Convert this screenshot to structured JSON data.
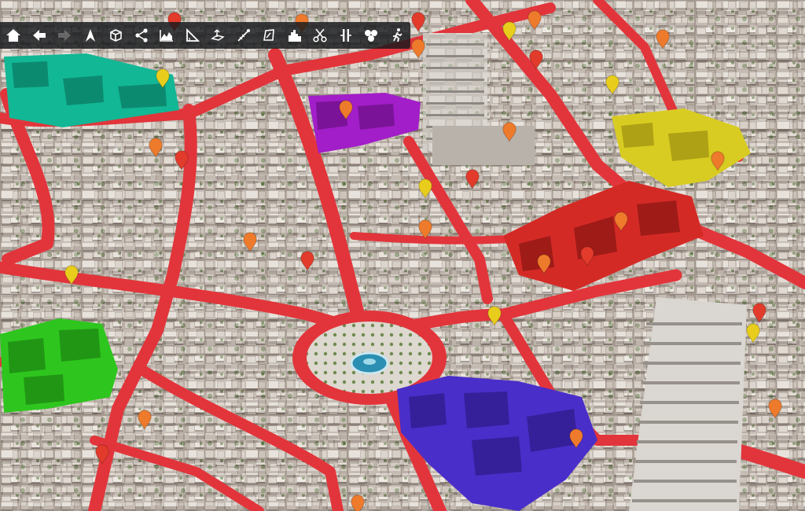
{
  "map": {
    "view": "3d-city-aerial",
    "colors": {
      "road": "#e2353b",
      "district_teal": "#12b795",
      "district_magenta": "#a21ec8",
      "district_yellow": "#d8cc22",
      "district_red": "#d42a26",
      "district_green": "#2ec61e",
      "district_blue": "#4a2ec9",
      "pin_orange": "#ee7a2c",
      "pin_red": "#e23b2b",
      "pin_yellow": "#e9cd1c"
    },
    "districts": [
      {
        "name": "teal-district",
        "color": "#12b795"
      },
      {
        "name": "magenta-district",
        "color": "#a21ec8"
      },
      {
        "name": "yellow-district",
        "color": "#d8cc22"
      },
      {
        "name": "red-district",
        "color": "#d42a26"
      },
      {
        "name": "green-district",
        "color": "#2ec61e"
      },
      {
        "name": "blue-district",
        "color": "#4a2ec9"
      }
    ],
    "pin_count": 31
  },
  "toolbar": {
    "tools": [
      {
        "icon": "home-icon",
        "state": "normal"
      },
      {
        "icon": "arrow-left-icon",
        "state": "normal"
      },
      {
        "icon": "arrow-right-icon",
        "state": "disabled"
      },
      {
        "icon": "pointer-icon",
        "state": "normal"
      },
      {
        "icon": "cube-icon",
        "state": "normal"
      },
      {
        "icon": "share-icon",
        "state": "normal"
      },
      {
        "icon": "terrain-profile-icon",
        "state": "normal"
      },
      {
        "icon": "angle-measure-icon",
        "state": "normal"
      },
      {
        "icon": "section-plane-icon",
        "state": "normal"
      },
      {
        "icon": "line-measure-icon",
        "state": "normal"
      },
      {
        "icon": "area-measure-icon",
        "state": "normal"
      },
      {
        "icon": "city-buildings-icon",
        "state": "normal"
      },
      {
        "icon": "scissors-icon",
        "state": "normal"
      },
      {
        "icon": "split-view-icon",
        "state": "normal"
      },
      {
        "icon": "layers-blob-icon",
        "state": "normal"
      },
      {
        "icon": "person-walk-icon",
        "state": "normal"
      }
    ]
  }
}
